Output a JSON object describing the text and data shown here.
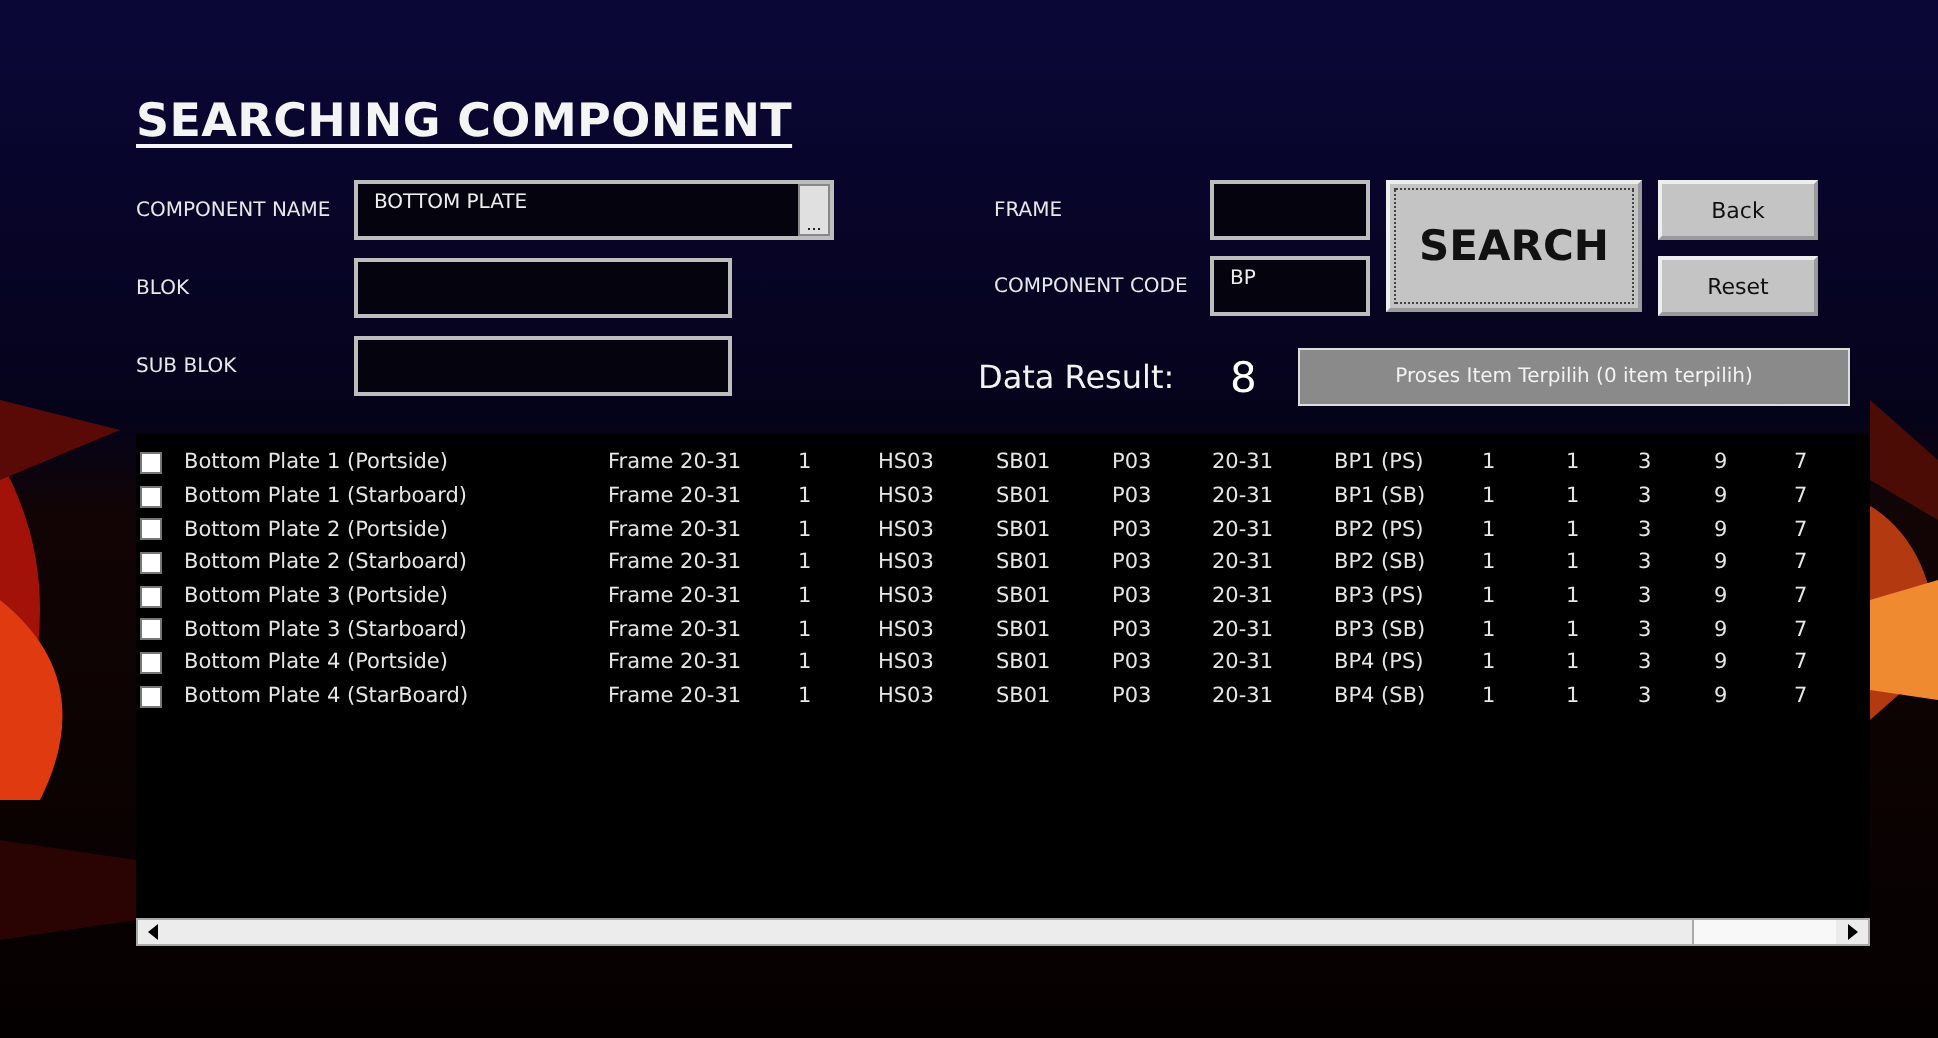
{
  "title": "SEARCHING COMPONENT",
  "form": {
    "component_name": {
      "label": "COMPONENT NAME",
      "value": "BOTTOM PLATE",
      "browse": "..."
    },
    "blok": {
      "label": "BLOK"
    },
    "sub_blok": {
      "label": "SUB BLOK"
    },
    "frame": {
      "label": "FRAME"
    },
    "component_code": {
      "label": "COMPONENT CODE",
      "value": "BP"
    }
  },
  "buttons": {
    "search": "SEARCH",
    "back": "Back",
    "reset": "Reset"
  },
  "result": {
    "label": "Data Result:",
    "count": "8",
    "process_button": {
      "label": "Proses Item Terpilih (0 item terpilih)",
      "disabled": true
    }
  },
  "rows": [
    {
      "checked": false,
      "cells": [
        "Bottom Plate 1 (Portside)",
        "Frame 20-31",
        "1",
        "HS03",
        "SB01",
        "P03",
        "20-31",
        "BP1 (PS)",
        "1",
        "1",
        "3",
        "9",
        "7"
      ]
    },
    {
      "checked": false,
      "cells": [
        "Bottom Plate 1 (Starboard)",
        "Frame 20-31",
        "1",
        "HS03",
        "SB01",
        "P03",
        "20-31",
        "BP1 (SB)",
        "1",
        "1",
        "3",
        "9",
        "7"
      ]
    },
    {
      "checked": false,
      "cells": [
        "Bottom Plate 2 (Portside)",
        "Frame 20-31",
        "1",
        "HS03",
        "SB01",
        "P03",
        "20-31",
        "BP2 (PS)",
        "1",
        "1",
        "3",
        "9",
        "7"
      ]
    },
    {
      "checked": false,
      "cells": [
        "Bottom Plate 2 (Starboard)",
        "Frame 20-31",
        "1",
        "HS03",
        "SB01",
        "P03",
        "20-31",
        "BP2 (SB)",
        "1",
        "1",
        "3",
        "9",
        "7"
      ]
    },
    {
      "checked": false,
      "cells": [
        "Bottom Plate 3 (Portside)",
        "Frame 20-31",
        "1",
        "HS03",
        "SB01",
        "P03",
        "20-31",
        "BP3 (PS)",
        "1",
        "1",
        "3",
        "9",
        "7"
      ]
    },
    {
      "checked": false,
      "cells": [
        "Bottom Plate 3 (Starboard)",
        "Frame 20-31",
        "1",
        "HS03",
        "SB01",
        "P03",
        "20-31",
        "BP3 (SB)",
        "1",
        "1",
        "3",
        "9",
        "7"
      ]
    },
    {
      "checked": false,
      "cells": [
        "Bottom Plate 4 (Portside)",
        "Frame 20-31",
        "1",
        "HS03",
        "SB01",
        "P03",
        "20-31",
        "BP4 (PS)",
        "1",
        "1",
        "3",
        "9",
        "7"
      ]
    },
    {
      "checked": false,
      "cells": [
        "Bottom Plate 4 (StarBoard)",
        "Frame 20-31",
        "1",
        "HS03",
        "SB01",
        "P03",
        "20-31",
        "BP4 (SB)",
        "1",
        "1",
        "3",
        "9",
        "7"
      ]
    }
  ]
}
